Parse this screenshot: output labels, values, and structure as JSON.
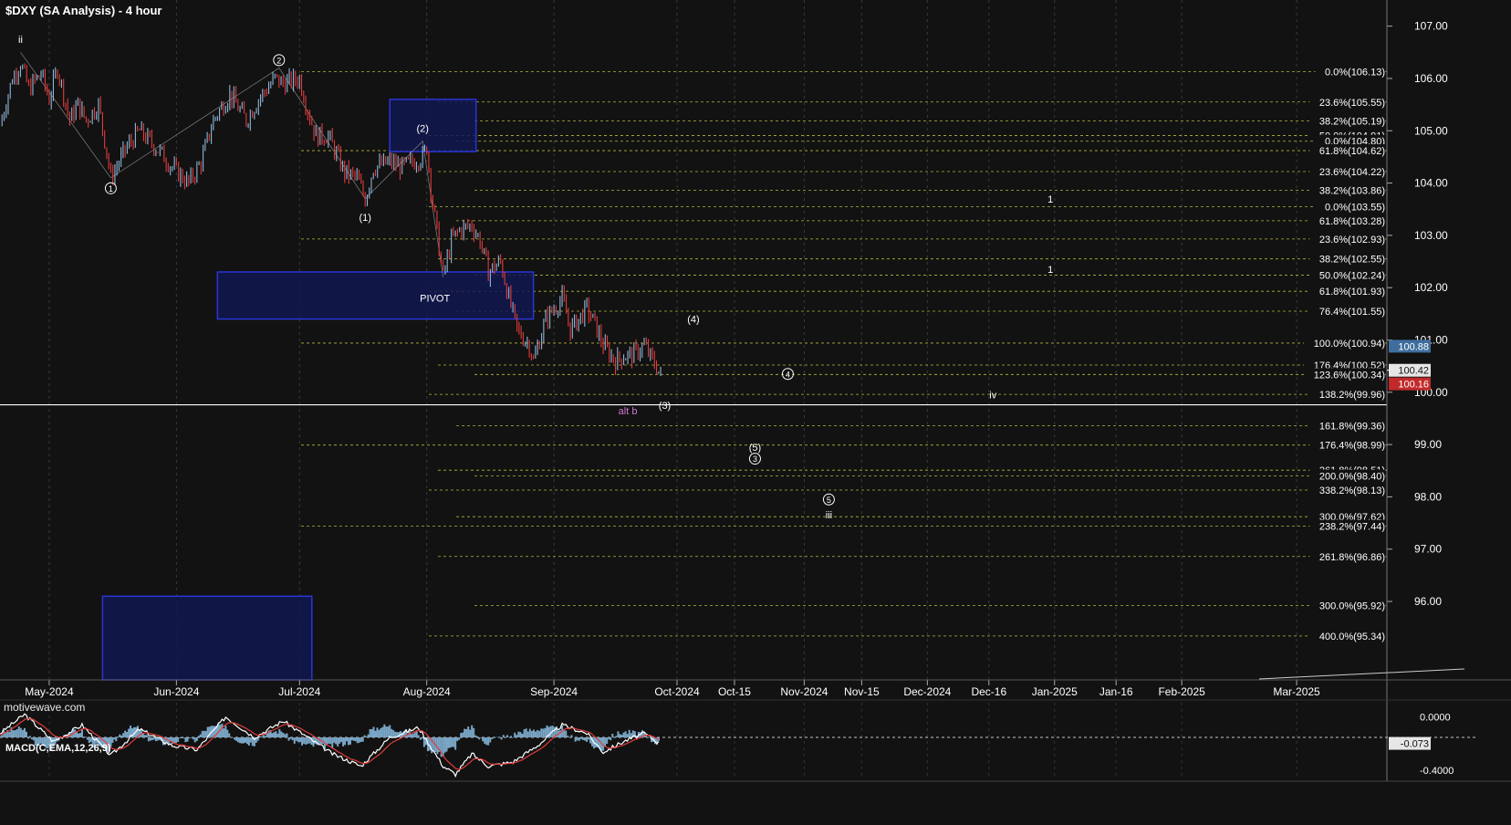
{
  "header": {
    "title": "$DXY (SA Analysis) - 4 hour",
    "watermark": "motivewave.com"
  },
  "macd": {
    "title": "MACD(C,EMA,12,26,9)",
    "ticks": [
      "0.0000",
      "-0.073",
      "-0.4000"
    ]
  },
  "colors": {
    "background": "#121212",
    "up": "#8fb6d8",
    "down": "#e03c3c",
    "fib_line": "#b5b53a",
    "zone": "#101850",
    "zone_border": "#2a35d6",
    "badge_blue": "#3f6e9e",
    "badge_red": "#c22a2a",
    "alt_label": "#d278d2",
    "macd_hist": "#7aa7c7"
  },
  "chart_data": {
    "type": "candlestick",
    "title": "$DXY (SA Analysis) - 4 hour",
    "ylim": [
      94.5,
      107.5
    ],
    "y_ticks": [
      "107.00",
      "106.00",
      "105.00",
      "104.00",
      "103.00",
      "102.00",
      "101.00",
      "100.00",
      "99.00",
      "98.00",
      "97.00",
      "96.00"
    ],
    "x_ticks": [
      "May-2024",
      "Jun-2024",
      "Jul-2024",
      "Aug-2024",
      "Sep-2024",
      "Oct-2024",
      "Oct-15",
      "Nov-2024",
      "Nov-15",
      "Dec-2024",
      "Dec-16",
      "Jan-2025",
      "Jan-16",
      "Feb-2025",
      "Mar-2025"
    ],
    "price_path": [
      [
        "2024-04-19",
        105.1
      ],
      [
        "2024-04-22",
        106.0
      ],
      [
        "2024-04-24",
        106.3
      ],
      [
        "2024-04-26",
        105.8
      ],
      [
        "2024-04-29",
        106.1
      ],
      [
        "2024-05-01",
        105.6
      ],
      [
        "2024-05-03",
        106.2
      ],
      [
        "2024-05-06",
        105.2
      ],
      [
        "2024-05-08",
        105.5
      ],
      [
        "2024-05-10",
        105.2
      ],
      [
        "2024-05-13",
        105.5
      ],
      [
        "2024-05-15",
        104.6
      ],
      [
        "2024-05-16",
        104.1
      ],
      [
        "2024-05-20",
        104.7
      ],
      [
        "2024-05-23",
        105.0
      ],
      [
        "2024-05-28",
        104.6
      ],
      [
        "2024-05-31",
        104.3
      ],
      [
        "2024-06-04",
        104.0
      ],
      [
        "2024-06-07",
        104.4
      ],
      [
        "2024-06-10",
        105.2
      ],
      [
        "2024-06-14",
        105.7
      ],
      [
        "2024-06-18",
        105.2
      ],
      [
        "2024-06-21",
        105.6
      ],
      [
        "2024-06-25",
        106.0
      ],
      [
        "2024-06-27",
        105.9
      ],
      [
        "2024-07-01",
        106.0
      ],
      [
        "2024-07-03",
        105.4
      ],
      [
        "2024-07-05",
        104.9
      ],
      [
        "2024-07-08",
        104.9
      ],
      [
        "2024-07-12",
        104.2
      ],
      [
        "2024-07-15",
        104.1
      ],
      [
        "2024-07-17",
        103.7
      ],
      [
        "2024-07-19",
        104.3
      ],
      [
        "2024-07-23",
        104.4
      ],
      [
        "2024-07-26",
        104.3
      ],
      [
        "2024-07-31",
        104.5
      ],
      [
        "2024-08-01",
        104.7
      ],
      [
        "2024-08-02",
        103.9
      ],
      [
        "2024-08-05",
        102.2
      ],
      [
        "2024-08-07",
        102.9
      ],
      [
        "2024-08-09",
        103.1
      ],
      [
        "2024-08-12",
        103.2
      ],
      [
        "2024-08-14",
        102.9
      ],
      [
        "2024-08-16",
        102.3
      ],
      [
        "2024-08-19",
        102.5
      ],
      [
        "2024-08-21",
        101.8
      ],
      [
        "2024-08-23",
        101.2
      ],
      [
        "2024-08-26",
        100.9
      ],
      [
        "2024-08-27",
        100.6
      ],
      [
        "2024-08-30",
        101.4
      ],
      [
        "2024-09-03",
        101.8
      ],
      [
        "2024-09-05",
        101.2
      ],
      [
        "2024-09-09",
        101.6
      ],
      [
        "2024-09-11",
        101.3
      ],
      [
        "2024-09-13",
        100.9
      ],
      [
        "2024-09-16",
        100.6
      ],
      [
        "2024-09-18",
        100.7
      ],
      [
        "2024-09-20",
        100.7
      ],
      [
        "2024-09-23",
        100.9
      ],
      [
        "2024-09-25",
        100.6
      ],
      [
        "2024-09-26",
        100.5
      ],
      [
        "2024-09-27",
        100.3
      ]
    ],
    "last_price": 100.42,
    "price_badges": [
      {
        "text": "100.88",
        "value": 100.88,
        "color": "#3f6e9e"
      },
      {
        "text": "100.42",
        "value": 100.42,
        "color": "#e6e6e6"
      },
      {
        "text": "100.16",
        "value": 100.16,
        "color": "#c22a2a"
      }
    ],
    "fib_levels": [
      {
        "label": "0.0%(106.13)",
        "value": 106.13
      },
      {
        "label": "23.6%(105.55)",
        "value": 105.55
      },
      {
        "label": "38.2%(105.19)",
        "value": 105.19
      },
      {
        "label": "50.0%(104.91)",
        "value": 104.91
      },
      {
        "label": "0.0%(104.80)",
        "value": 104.8
      },
      {
        "label": "61.8%(104.62)",
        "value": 104.62
      },
      {
        "label": "23.6%(104.22)",
        "value": 104.22
      },
      {
        "label": "38.2%(103.86)",
        "value": 103.86
      },
      {
        "label": "0.0%(103.55)",
        "value": 103.55
      },
      {
        "label": "61.8%(103.28)",
        "value": 103.28
      },
      {
        "label": "23.6%(102.93)",
        "value": 102.93
      },
      {
        "label": "38.2%(102.55)",
        "value": 102.55
      },
      {
        "label": "50.0%(102.24)",
        "value": 102.24
      },
      {
        "label": "61.8%(101.93)",
        "value": 101.93
      },
      {
        "label": "76.4%(101.55)",
        "value": 101.55
      },
      {
        "label": "100.0%(100.94)",
        "value": 100.94
      },
      {
        "label": "176.4%(100.52)",
        "value": 100.52
      },
      {
        "label": "123.6%(100.34)",
        "value": 100.34
      },
      {
        "label": "138.2%(99.96)",
        "value": 99.96
      },
      {
        "label": "161.8%(99.36)",
        "value": 99.36
      },
      {
        "label": "176.4%(98.99)",
        "value": 98.99
      },
      {
        "label": "261.8%(98.51)",
        "value": 98.51
      },
      {
        "label": "200.0%(98.40)",
        "value": 98.4
      },
      {
        "label": "338.2%(98.13)",
        "value": 98.13
      },
      {
        "label": "300.0%(97.62)",
        "value": 97.62
      },
      {
        "label": "238.2%(97.44)",
        "value": 97.44
      },
      {
        "label": "261.8%(96.86)",
        "value": 96.86
      },
      {
        "label": "300.0%(95.92)",
        "value": 95.92
      },
      {
        "label": "400.0%(95.34)",
        "value": 95.34
      }
    ],
    "horizontal_line": 99.76,
    "zones": [
      {
        "from": "2024-07-23",
        "to": "2024-08-13",
        "top": 105.6,
        "bottom": 104.6
      },
      {
        "from": "2024-06-11",
        "to": "2024-08-27",
        "top": 102.3,
        "bottom": 101.4
      },
      {
        "from": "2024-05-14",
        "to": "2024-07-04",
        "top": 96.1,
        "bottom": 94.5
      }
    ],
    "annotations": [
      {
        "text": "ii",
        "date": "2024-04-24",
        "value": 106.75,
        "color": "#ffffff",
        "circle": false
      },
      {
        "text": "1",
        "date": "2024-05-16",
        "value": 103.9,
        "color": "#ffffff",
        "circle": true
      },
      {
        "text": "2",
        "date": "2024-06-26",
        "value": 106.35,
        "color": "#ffffff",
        "circle": true
      },
      {
        "text": "(1)",
        "date": "2024-07-17",
        "value": 103.35,
        "color": "#ffffff",
        "circle": false
      },
      {
        "text": "(2)",
        "date": "2024-07-31",
        "value": 105.05,
        "color": "#ffffff",
        "circle": false
      },
      {
        "text": "PIVOT",
        "date": "2024-08-03",
        "value": 101.8,
        "color": "#ffffff",
        "circle": false
      },
      {
        "text": "(4)",
        "date": "2024-10-05",
        "value": 101.4,
        "color": "#ffffff",
        "circle": false
      },
      {
        "text": "4",
        "date": "2024-10-28",
        "value": 100.35,
        "color": "#ffffff",
        "circle": true
      },
      {
        "text": "(3)",
        "date": "2024-09-28",
        "value": 99.75,
        "color": "#ffffff",
        "circle": false
      },
      {
        "text": "alt b",
        "date": "2024-09-19",
        "value": 99.65,
        "color": "#d278d2",
        "circle": false
      },
      {
        "text": "iv",
        "date": "2024-12-17",
        "value": 99.95,
        "color": "#ffffff",
        "circle": false
      },
      {
        "text": "(5)",
        "date": "2024-10-20",
        "value": 98.95,
        "color": "#ffffff",
        "circle": false
      },
      {
        "text": "3",
        "date": "2024-10-20",
        "value": 98.73,
        "color": "#ffffff",
        "circle": true
      },
      {
        "text": "5",
        "date": "2024-11-07",
        "value": 97.95,
        "color": "#ffffff",
        "circle": true
      },
      {
        "text": "iii",
        "date": "2024-11-07",
        "value": 97.66,
        "color": "#ffffff",
        "circle": false
      },
      {
        "text": "1",
        "date": "2024-12-31",
        "value": 103.7,
        "color": "#ffffff",
        "circle": false
      },
      {
        "text": "1",
        "date": "2024-12-31",
        "value": 102.35,
        "color": "#ffffff",
        "circle": false
      }
    ],
    "macd_path": [
      [
        "2024-04-19",
        0.05
      ],
      [
        "2024-04-25",
        0.28
      ],
      [
        "2024-05-02",
        -0.05
      ],
      [
        "2024-05-09",
        0.15
      ],
      [
        "2024-05-16",
        -0.22
      ],
      [
        "2024-05-23",
        0.1
      ],
      [
        "2024-05-31",
        -0.1
      ],
      [
        "2024-06-06",
        -0.15
      ],
      [
        "2024-06-13",
        0.25
      ],
      [
        "2024-06-20",
        0.0
      ],
      [
        "2024-06-27",
        0.2
      ],
      [
        "2024-07-03",
        0.0
      ],
      [
        "2024-07-09",
        -0.2
      ],
      [
        "2024-07-16",
        -0.35
      ],
      [
        "2024-07-23",
        0.0
      ],
      [
        "2024-07-30",
        0.12
      ],
      [
        "2024-08-05",
        -0.35
      ],
      [
        "2024-08-08",
        -0.45
      ],
      [
        "2024-08-12",
        -0.2
      ],
      [
        "2024-08-16",
        -0.35
      ],
      [
        "2024-08-22",
        -0.3
      ],
      [
        "2024-08-28",
        -0.1
      ],
      [
        "2024-09-03",
        0.15
      ],
      [
        "2024-09-09",
        0.05
      ],
      [
        "2024-09-13",
        -0.18
      ],
      [
        "2024-09-18",
        -0.05
      ],
      [
        "2024-09-23",
        0.05
      ],
      [
        "2024-09-27",
        -0.08
      ]
    ]
  }
}
